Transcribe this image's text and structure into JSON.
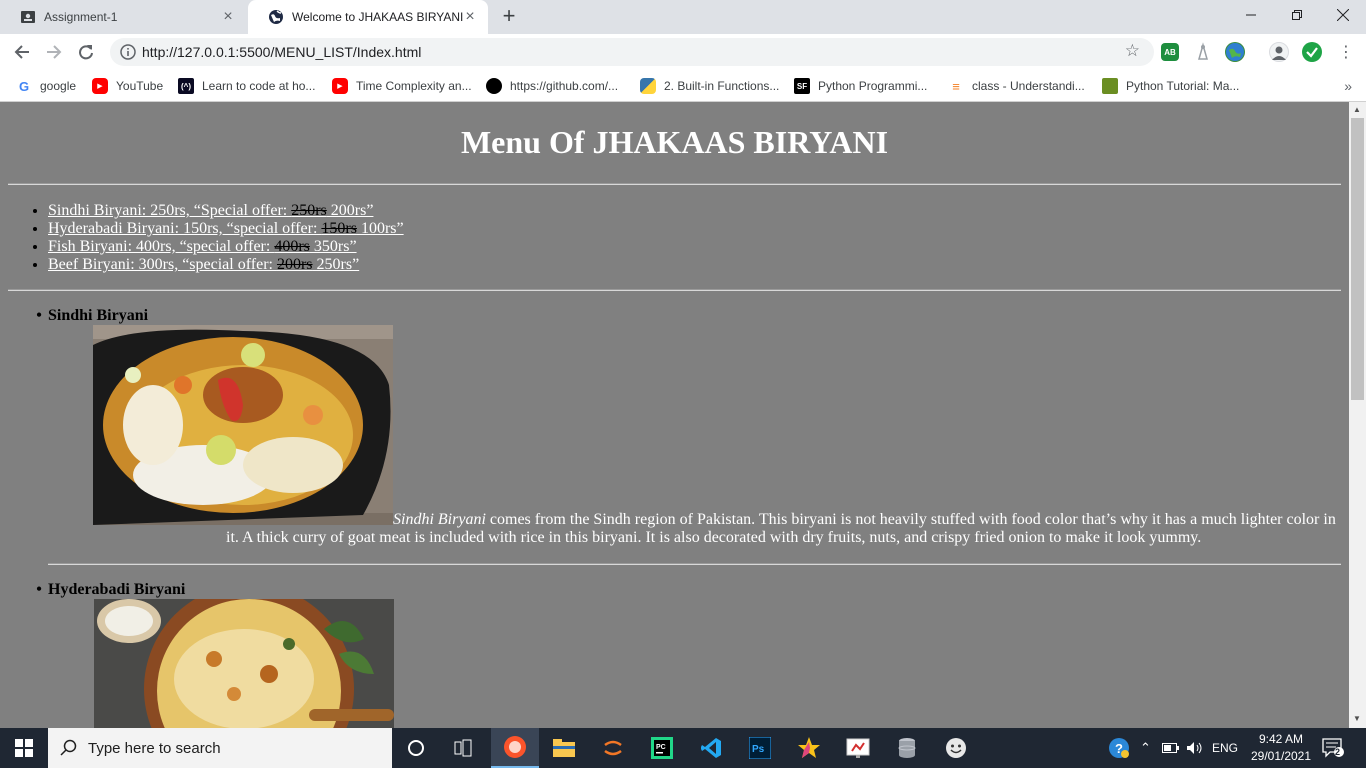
{
  "browser": {
    "tabs": [
      {
        "title": "Assignment-1",
        "active": false
      },
      {
        "title": "Welcome to JHAKAAS BIRYANI",
        "active": true
      }
    ],
    "new_tab": "+",
    "url": "http://127.0.0.1:5500/MENU_LIST/Index.html",
    "bookmarks": [
      {
        "label": "google",
        "icon": "google-icon",
        "color": "#4285f4"
      },
      {
        "label": "YouTube",
        "icon": "youtube-icon",
        "color": "#ff0000"
      },
      {
        "label": "Learn to code at ho...",
        "icon": "code-icon",
        "color": "#0a0a23"
      },
      {
        "label": "Time Complexity an...",
        "icon": "youtube-icon",
        "color": "#ff0000"
      },
      {
        "label": "https://github.com/...",
        "icon": "github-icon",
        "color": "#000000"
      },
      {
        "label": "2. Built-in Functions...",
        "icon": "python-icon",
        "color": "#3776ab"
      },
      {
        "label": "Python Programmi...",
        "icon": "sf-icon",
        "color": "#000000"
      },
      {
        "label": "class - Understandi...",
        "icon": "stackoverflow-icon",
        "color": "#f48024"
      },
      {
        "label": "Python Tutorial: Ma...",
        "icon": "tutorial-icon",
        "color": "#6b8e23"
      }
    ],
    "bookmarks_more": "»"
  },
  "page": {
    "title": "Menu Of JHAKAAS BIRYANI",
    "offers": [
      {
        "pre": "Sindhi Biryani: 250rs, “Special offer: ",
        "old": "250rs",
        "post": " 200rs”"
      },
      {
        "pre": "Hyderabadi Biryani: 150rs, “special offer: ",
        "old": "150rs",
        "post": " 100rs”"
      },
      {
        "pre": "Fish Biryani: 400rs, “special offer: ",
        "old": "400rs",
        "post": " 350rs”"
      },
      {
        "pre": "Beef Biryani: 300rs, “special offer: ",
        "old": "200rs",
        "post": " 250rs”"
      }
    ],
    "dishes": [
      {
        "name": "Sindhi Biryani",
        "desc_em": "Sindhi Biryani",
        "desc_line1": " comes from the Sindh region of Pakistan. This biryani is not heavily stuffed with food color that’s why it has a much lighter color in",
        "desc_line2": "it. A thick curry of goat meat is included with rice in this biryani. It is also decorated with dry fruits, nuts, and crispy fried onion to make it look yummy."
      },
      {
        "name": "Hyderabadi Biryani"
      }
    ],
    "background": "#808080"
  },
  "taskbar": {
    "search_placeholder": "Type here to search",
    "lang": "ENG",
    "time": "9:42 AM",
    "date": "29/01/2021",
    "notifications": "2"
  }
}
